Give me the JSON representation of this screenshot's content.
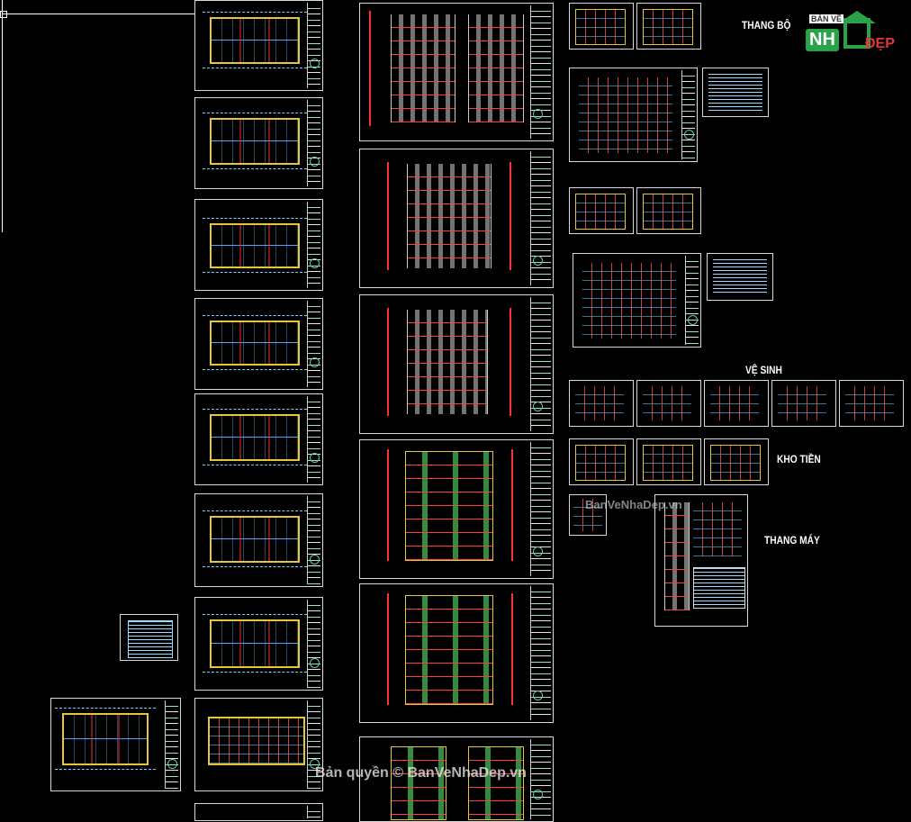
{
  "labels": {
    "thang_bo": "THANG BỘ",
    "ve_sinh": "VỆ SINH",
    "kho_tien": "KHO TIỀN",
    "thang_may": "THANG MÁY"
  },
  "watermark": {
    "main": "Bản quyền © BanVeNhaDep.vn",
    "secondary": "BanVeNhaDep.vn"
  },
  "logo": {
    "top": "BẢN VẼ",
    "left": "NH",
    "right": "ĐẸP"
  },
  "colors": {
    "background": "#000000",
    "sheet_border": "#d9d9d9",
    "wall_yellow": "#e7c63a",
    "axis_red": "#ff3030",
    "dim_cyan": "#5ecfff",
    "logo_green": "#2aa24a",
    "logo_red": "#e03838"
  }
}
